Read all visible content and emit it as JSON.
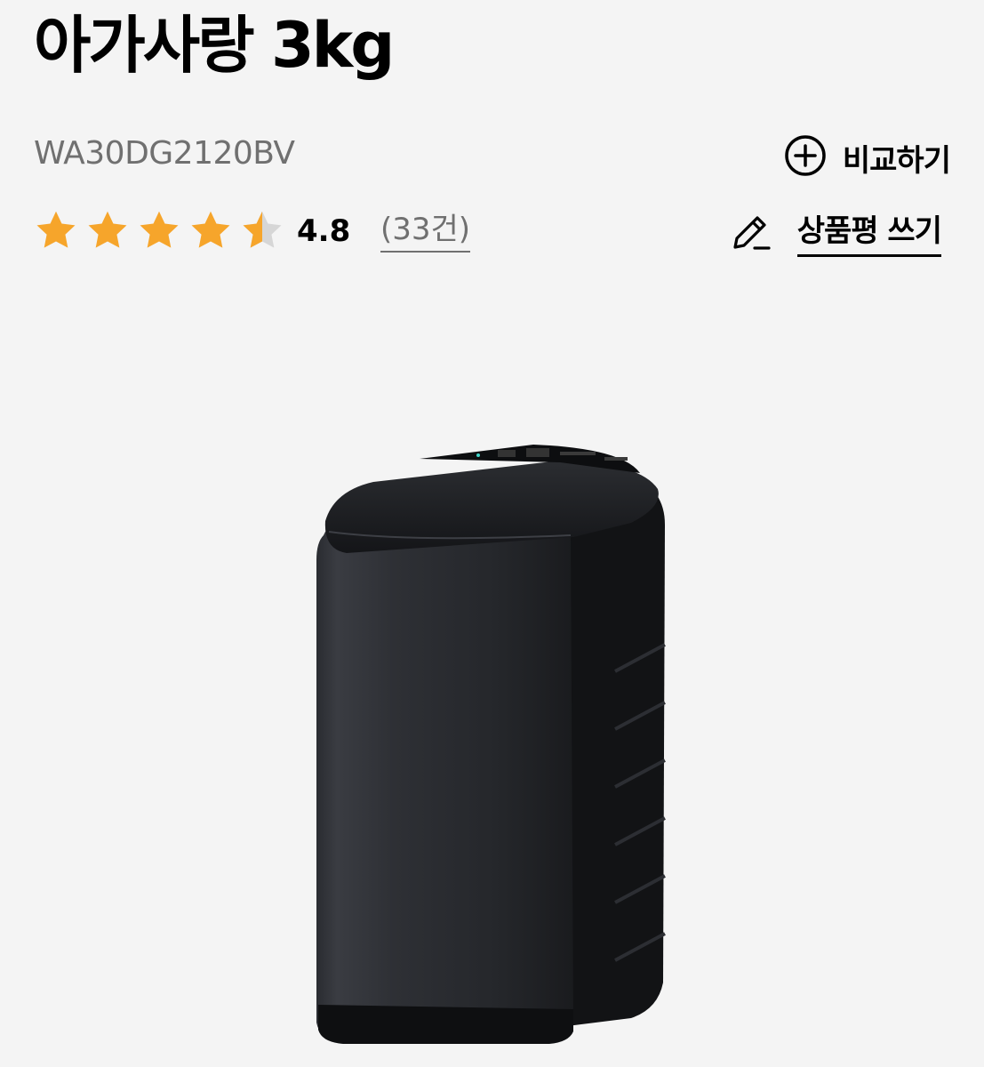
{
  "product": {
    "name": "아가사랑 3kg",
    "model": "WA30DG2120BV",
    "rating": "4.8",
    "rating_value": 4.8,
    "rating_max": 5,
    "review_count": "(33건)",
    "image_alt": "washing-machine-product-image"
  },
  "actions": {
    "compare_label": "비교하기",
    "write_review_label": "상품평 쓰기"
  },
  "colors": {
    "star_filled": "#f6a52b",
    "star_empty": "#d6d6d6",
    "background": "#f4f4f4"
  }
}
